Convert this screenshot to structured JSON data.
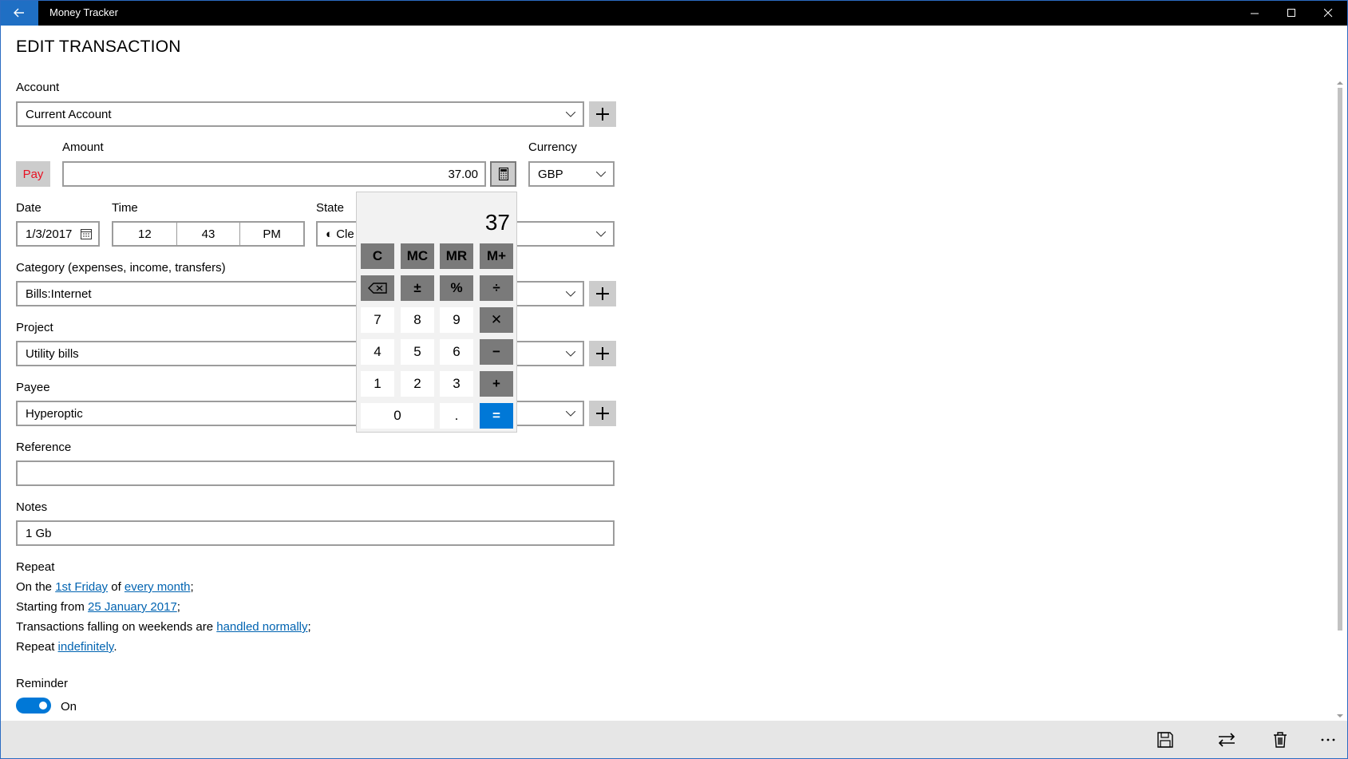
{
  "window": {
    "title": "Money Tracker"
  },
  "page": {
    "title": "EDIT TRANSACTION"
  },
  "account": {
    "label": "Account",
    "value": "Current Account"
  },
  "amount": {
    "label": "Amount",
    "pay_label": "Pay",
    "value": "37.00"
  },
  "currency": {
    "label": "Currency",
    "value": "GBP"
  },
  "date": {
    "label": "Date",
    "value": "1/3/2017"
  },
  "time": {
    "label": "Time",
    "hour": "12",
    "minute": "43",
    "period": "PM"
  },
  "state": {
    "label": "State",
    "value": "◐ Cle"
  },
  "category": {
    "label": "Category (expenses, income, transfers)",
    "value": "Bills:Internet"
  },
  "project": {
    "label": "Project",
    "value": "Utility bills"
  },
  "payee": {
    "label": "Payee",
    "value": "Hyperoptic"
  },
  "reference": {
    "label": "Reference",
    "value": ""
  },
  "notes": {
    "label": "Notes",
    "value": "1 Gb"
  },
  "repeat": {
    "label": "Repeat",
    "line1": {
      "pre": "On the ",
      "link1": "1st Friday",
      "mid": " of ",
      "link2": "every month",
      "post": ";"
    },
    "line2": {
      "pre": "Starting from ",
      "link": "25 January 2017",
      "post": ";"
    },
    "line3": {
      "pre": "Transactions falling on weekends are ",
      "link": "handled normally",
      "post": ";"
    },
    "line4": {
      "pre": "Repeat ",
      "link": "indefinitely",
      "post": "."
    }
  },
  "reminder": {
    "label": "Reminder",
    "state": "On"
  },
  "calculator": {
    "display": "37",
    "keys": {
      "c": "C",
      "mc": "MC",
      "mr": "MR",
      "mplus": "M+",
      "plusminus": "±",
      "percent": "%",
      "divide": "÷",
      "k7": "7",
      "k8": "8",
      "k9": "9",
      "multiply": "✕",
      "k4": "4",
      "k5": "5",
      "k6": "6",
      "minus": "−",
      "k1": "1",
      "k2": "2",
      "k3": "3",
      "plus": "+",
      "k0": "0",
      "dot": ".",
      "equals": "="
    }
  },
  "icons": {
    "back": "back-arrow-icon",
    "minimize": "minimize-icon",
    "maximize": "maximize-icon",
    "close": "close-icon",
    "save": "save-icon",
    "transfer": "swap-icon",
    "delete": "trash-icon",
    "more": "more-icon",
    "calendar": "calendar-icon",
    "calculator": "calculator-icon",
    "backspace": "backspace-icon"
  },
  "colors": {
    "accent": "#0078d7",
    "pay": "#e81123",
    "link": "#0063b1"
  }
}
